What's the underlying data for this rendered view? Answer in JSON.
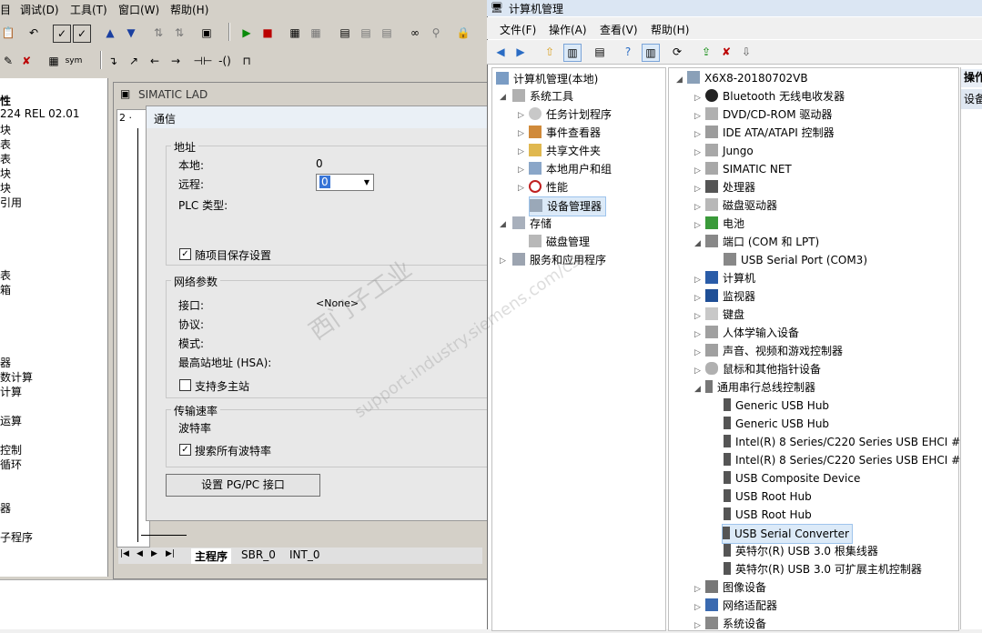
{
  "left_app": {
    "menu": [
      "调试(D)",
      "工具(T)",
      "窗口(W)",
      "帮助(H)"
    ],
    "tree_items": [
      "性",
      "224 REL 02.01",
      "块",
      "表",
      "表",
      "块",
      "块",
      "引用",
      "表",
      "箱",
      "器",
      "数计算",
      "计算",
      "运算",
      "控制",
      "循环",
      "器",
      "子程序"
    ],
    "lad_title": "SIMATIC LAD",
    "lad_row": "2 ·",
    "tabs": [
      "主程序",
      "SBR_0",
      "INT_0"
    ],
    "dialog": {
      "title": "通信",
      "address_group": "地址",
      "local_label": "本地:",
      "local_value": "0",
      "remote_label": "远程:",
      "remote_value": "0",
      "plc_type_label": "PLC 类型:",
      "save_with_project": "随项目保存设置",
      "network_group": "网络参数",
      "interface_label": "接口:",
      "interface_value": "<None>",
      "protocol_label": "协议:",
      "mode_label": "模式:",
      "hsa_label": "最高站地址 (HSA):",
      "multi_master": "支持多主站",
      "speed_group": "传输速率",
      "baud_label": "波特率",
      "search_all_baud": "搜索所有波特率",
      "set_pgpc_button": "设置 PG/PC 接口"
    }
  },
  "right_app": {
    "title": "计算机管理",
    "menu": [
      "文件(F)",
      "操作(A)",
      "查看(V)",
      "帮助(H)"
    ],
    "left_tree": [
      "计算机管理(本地)",
      "系统工具",
      "任务计划程序",
      "事件查看器",
      "共享文件夹",
      "本地用户和组",
      "性能",
      "设备管理器",
      "存储",
      "磁盘管理",
      "服务和应用程序"
    ],
    "device_tree": [
      "X6X8-20180702VB",
      "Bluetooth 无线电收发器",
      "DVD/CD-ROM 驱动器",
      "IDE ATA/ATAPI 控制器",
      "Jungo",
      "SIMATIC NET",
      "处理器",
      "磁盘驱动器",
      "电池",
      "端口 (COM 和 LPT)",
      "USB Serial Port (COM3)",
      "计算机",
      "监视器",
      "键盘",
      "人体学输入设备",
      "声音、视频和游戏控制器",
      "鼠标和其他指针设备",
      "通用串行总线控制器",
      "Generic USB Hub",
      "Generic USB Hub",
      "Intel(R) 8 Series/C220 Series USB EHCI #",
      "Intel(R) 8 Series/C220 Series USB EHCI #",
      "USB Composite Device",
      "USB Root Hub",
      "USB Root Hub",
      "USB Serial Converter",
      "英特尔(R) USB 3.0 根集线器",
      "英特尔(R) USB 3.0 可扩展主机控制器",
      "图像设备",
      "网络适配器",
      "系统设备"
    ],
    "actions_header": "操作",
    "actions_item": "设备"
  },
  "watermark": {
    "line1": "西门子工业",
    "line2": "support.industry.siemens.com/cs"
  },
  "colors": {
    "selection": "#dceaf8",
    "title_bar": "#dbe6f3"
  }
}
